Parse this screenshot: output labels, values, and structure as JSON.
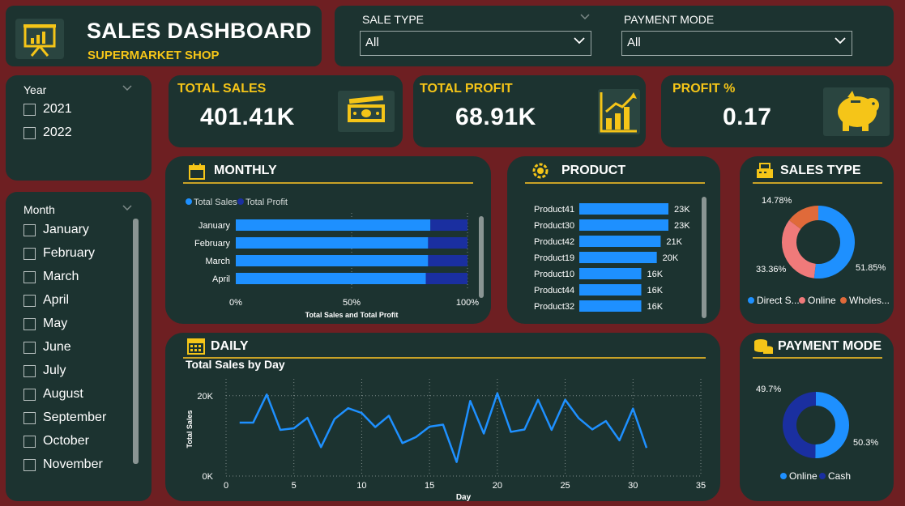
{
  "header": {
    "title": "SALES DASHBOARD",
    "subtitle": "SUPERMARKET SHOP"
  },
  "filters": {
    "sale_type": {
      "label": "SALE TYPE",
      "value": "All"
    },
    "payment_mode": {
      "label": "PAYMENT MODE",
      "value": "All"
    }
  },
  "year_slicer": {
    "label": "Year",
    "items": [
      "2021",
      "2022"
    ]
  },
  "month_slicer": {
    "label": "Month",
    "items": [
      "January",
      "February",
      "March",
      "April",
      "May",
      "June",
      "July",
      "August",
      "September",
      "October",
      "November"
    ]
  },
  "kpis": {
    "total_sales": {
      "label": "TOTAL SALES",
      "value": "401.41K"
    },
    "total_profit": {
      "label": "TOTAL PROFIT",
      "value": "68.91K"
    },
    "profit_pct": {
      "label": "PROFIT %",
      "value": "0.17"
    }
  },
  "sections": {
    "monthly": "MONTHLY",
    "product": "PRODUCT",
    "sales_type": "SALES TYPE",
    "daily": "DAILY",
    "payment_mode": "PAYMENT MODE"
  },
  "colors": {
    "background": "#6e1f22",
    "card": "#1c3330",
    "accent": "#f5c518",
    "bar_light": "#1e90ff",
    "bar_dark": "#1a2fa0",
    "line": "#1e90ff",
    "pie_online": "#f07a7a",
    "pie_wholesale": "#e06a3a"
  },
  "chart_data": [
    {
      "id": "monthly",
      "type": "bar",
      "orientation": "horizontal",
      "stacked_percent": true,
      "legend": [
        "Total Sales",
        "Total Profit"
      ],
      "categories": [
        "January",
        "February",
        "March",
        "April"
      ],
      "series": [
        {
          "name": "Total Sales",
          "values": [
            84,
            83,
            83,
            82
          ]
        },
        {
          "name": "Total Profit",
          "values": [
            16,
            17,
            17,
            18
          ]
        }
      ],
      "xticks": [
        "0%",
        "50%",
        "100%"
      ],
      "xlabel": "Total Sales and Total Profit"
    },
    {
      "id": "product",
      "type": "bar",
      "orientation": "horizontal",
      "categories": [
        "Product41",
        "Product30",
        "Product42",
        "Product19",
        "Product10",
        "Product44",
        "Product32"
      ],
      "values": [
        23,
        23,
        21,
        20,
        16,
        16,
        16
      ],
      "labels": [
        "23K",
        "23K",
        "21K",
        "20K",
        "16K",
        "16K",
        "16K"
      ]
    },
    {
      "id": "sales_type",
      "type": "pie",
      "donut": true,
      "categories": [
        "Direct S...",
        "Online",
        "Wholes..."
      ],
      "values": [
        51.85,
        33.36,
        14.78
      ],
      "labels": [
        "51.85%",
        "33.36%",
        "14.78%"
      ]
    },
    {
      "id": "daily",
      "type": "line",
      "title": "Total Sales by Day",
      "xlabel": "Day",
      "ylabel": "Total Sales",
      "xlim": [
        0,
        35
      ],
      "ylim": [
        0,
        25000
      ],
      "xticks": [
        0,
        5,
        10,
        15,
        20,
        25,
        30,
        35
      ],
      "yticks": [
        "0K",
        "20K"
      ],
      "x": [
        1,
        2,
        3,
        4,
        5,
        6,
        7,
        8,
        9,
        10,
        11,
        12,
        13,
        14,
        15,
        16,
        17,
        18,
        19,
        20,
        21,
        22,
        23,
        24,
        25,
        26,
        27,
        28,
        29,
        30,
        31
      ],
      "y": [
        13300,
        13300,
        20300,
        11500,
        11900,
        14500,
        7200,
        14200,
        16900,
        15700,
        12200,
        15000,
        8200,
        9700,
        12300,
        12800,
        3500,
        18700,
        10600,
        20600,
        11000,
        11600,
        19000,
        11500,
        19000,
        14400,
        11600,
        13700,
        8900,
        16800,
        7000
      ]
    },
    {
      "id": "payment_mode",
      "type": "pie",
      "donut": true,
      "categories": [
        "Online",
        "Cash"
      ],
      "values": [
        50.3,
        49.7
      ],
      "labels": [
        "50.3%",
        "49.7%"
      ]
    }
  ]
}
